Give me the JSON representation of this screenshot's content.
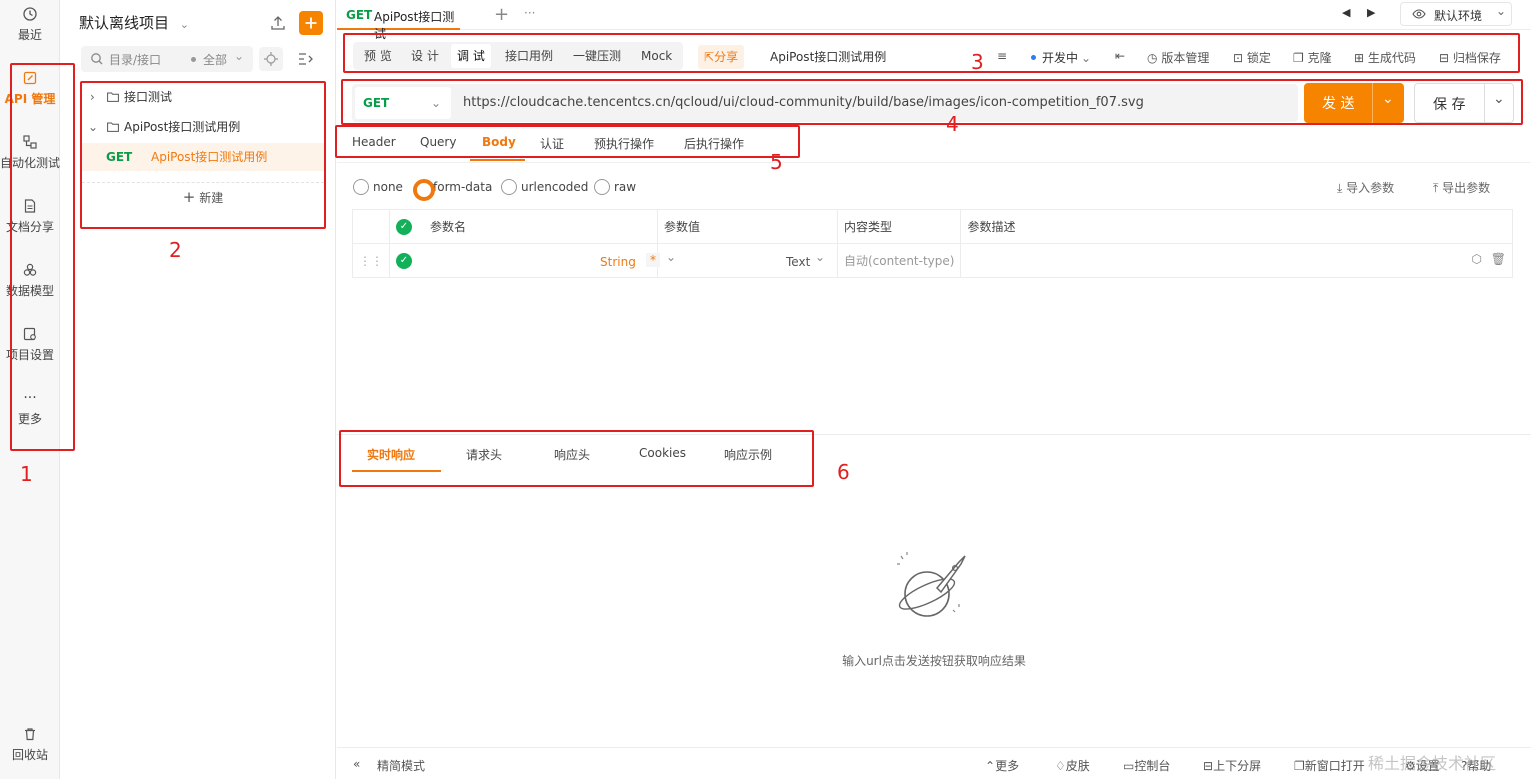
{
  "rail": {
    "recent": "最近",
    "api": "API 管理",
    "auto": "自动化测试",
    "docs": "文档分享",
    "model": "数据模型",
    "settings": "项目设置",
    "more_dots": "···",
    "more": "更多",
    "recycle": "回收站"
  },
  "tree": {
    "project_title": "默认离线项目",
    "search_placeholder": "目录/接口",
    "filter": "全部",
    "items": [
      {
        "label": "接口测试"
      },
      {
        "label": "ApiPost接口测试用例"
      },
      {
        "method": "GET",
        "label": "ApiPost接口测试用例"
      }
    ],
    "new_label": "新建"
  },
  "tabs": {
    "active_method": "GET",
    "active_title": "ApiPost接口测试",
    "plus": "+",
    "more": "···",
    "env": "默认环境"
  },
  "toolbar": {
    "segments": [
      "预 览",
      "设 计",
      "调 试",
      "接口用例",
      "一键压测",
      "Mock"
    ],
    "share": "分享",
    "doc_title": "ApiPost接口测试用例",
    "status": "开发中",
    "version": "版本管理",
    "lock": "锁定",
    "clone": "克隆",
    "gen_code": "生成代码",
    "archive": "归档保存"
  },
  "request": {
    "method": "GET",
    "url": "https://cloudcache.tencentcs.cn/qcloud/ui/cloud-community/build/base/images/icon-competition_f07.svg",
    "send": "发 送",
    "save": "保 存"
  },
  "subtabs": [
    "Header",
    "Query",
    "Body",
    "认证",
    "预执行操作",
    "后执行操作"
  ],
  "body_types": [
    "none",
    "form-data",
    "urlencoded",
    "raw"
  ],
  "body_actions": {
    "import": "导入参数",
    "export": "导出参数"
  },
  "params_table": {
    "headers": [
      "参数名",
      "参数值",
      "内容类型",
      "参数描述"
    ],
    "row": {
      "type": "String",
      "required": "*",
      "value_type": "Text",
      "content_type_placeholder": "自动(content-type)"
    }
  },
  "response": {
    "tabs": [
      "实时响应",
      "请求头",
      "响应头",
      "Cookies",
      "响应示例"
    ],
    "empty_text": "输入url点击发送按钮获取响应结果"
  },
  "statusbar": {
    "simple_mode": "精简模式",
    "items": [
      "更多",
      "皮肤",
      "控制台",
      "上下分屏",
      "新窗口打开",
      "设置",
      "帮助"
    ],
    "watermark": "稀土掘金技术社区"
  },
  "annotations": [
    "1",
    "2",
    "3",
    "4",
    "5",
    "6"
  ],
  "colors": {
    "accent": "#f0790f",
    "send": "#f78400",
    "get": "#0a9d49",
    "annotation": "#e02020"
  }
}
